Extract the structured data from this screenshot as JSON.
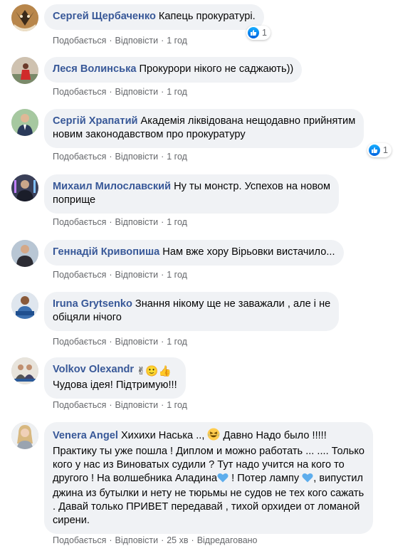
{
  "comments": [
    {
      "author": "Сергей Щербаченко",
      "text": "Капець прокуратурі.",
      "like": "Подобається",
      "reply": "Відповісти",
      "time": "1 год",
      "reactions": "1"
    },
    {
      "author": "Леся Волинська",
      "text": "Прокурори нікого не саджають))",
      "like": "Подобається",
      "reply": "Відповісти",
      "time": "1 год"
    },
    {
      "author": "Сергій Храпатий",
      "text_line1": "Академія ліквідована нещодавно прийнятим",
      "text_line2": "новим законодавством про прокуратуру",
      "like": "Подобається",
      "reply": "Відповісти",
      "time": "1 год",
      "reactions": "1"
    },
    {
      "author": "Михаил Милославский",
      "text_line1": "Ну ты монстр. Успехов на новом",
      "text_line2": "поприще",
      "like": "Подобається",
      "reply": "Відповісти",
      "time": "1 год"
    },
    {
      "author": "Геннадій Кривопиша",
      "text": "Нам вже хору Вірьовки вистачило...",
      "like": "Подобається",
      "reply": "Відповісти",
      "time": "1 год"
    },
    {
      "author": "Iruna Grytsenko",
      "text_line1": "Знання нікому ще не заважали , але і не",
      "text_line2": "обіцяли нічого",
      "like": "Подобається",
      "reply": "Відповісти",
      "time": "1 год"
    },
    {
      "author": "Volkov Olexandr",
      "emojis": "✌🙂👍",
      "text": "Чудова ідея! Підтримую!!!",
      "like": "Подобається",
      "reply": "Відповісти",
      "time": "1 год"
    },
    {
      "author": "Venera Angel",
      "text_line1a": "Хихихи Наська ..,",
      "text_line1b": "Давно Надо было !!!!!",
      "text_line2": "Практику ты уже пошла ! Диплом и можно работать ... .... Только",
      "text_line3": "кого у нас из Виноватых судили ? Тут надо учится на кого то",
      "text_line4a": "другого ! На волшебника Аладина",
      "text_line4b": "! Потер лампу",
      "text_line4c": ", випустил",
      "text_line5": "джина из бутылки и нету не тюрьмы не судов не тех кого сажать",
      "text_line6": ". Давай только ПРИВЕТ передавай , тихой орхидеи от ломаной",
      "text_line7": "сирени.",
      "like": "Подобається",
      "reply": "Відповісти",
      "time": "25 хв",
      "edited": "Відредаговано"
    }
  ],
  "colors": {
    "author": "#385898",
    "bubble": "#f0f2f5",
    "meta": "#65676b",
    "like": "#1877f2"
  }
}
